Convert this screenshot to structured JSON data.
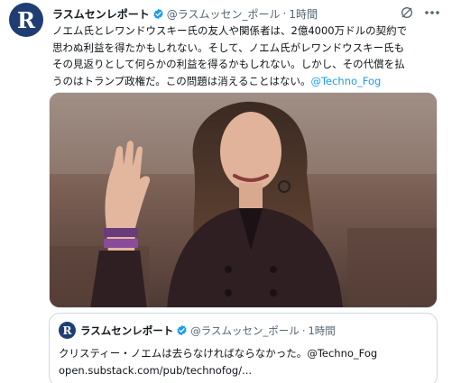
{
  "tweet": {
    "avatar_letter": "R",
    "display_name": "ラスムセンレポート",
    "handle": "@ラスムッセン_ポール",
    "separator": "·",
    "time": "1時間",
    "text_lines": [
      "ノエム氏とレワンドウスキー氏の友人や関係者は、2億4000万ドルの契約で",
      "思わぬ利益を得たかもしれない。そして、ノエム氏がレワンドウスキー氏も",
      "その見返りとして何らかの利益を得るかもしれない。しかし、その代償を払",
      "うのはトランプ政権だ。この問題は消えることはない。"
    ],
    "mention": "@Techno_Fog",
    "icons": {
      "verified": "verified-badge-icon",
      "grok": "grok-icon",
      "more": "more-icon"
    }
  },
  "quote": {
    "avatar_letter": "R",
    "display_name": "ラスムセンレポート",
    "handle": "@ラスムッセン_ポール",
    "separator": "·",
    "time": "1時間",
    "text": "クリスティー・ノエムは去らなければならなかった。",
    "mention": "@Techno_Fog",
    "link": "open.substack.com/pub/technofog/..."
  },
  "colors": {
    "link": "#1d9bf0",
    "verified": "#1d9bf0",
    "secondary_text": "#536471",
    "avatar_bg": "#1f3d73"
  }
}
